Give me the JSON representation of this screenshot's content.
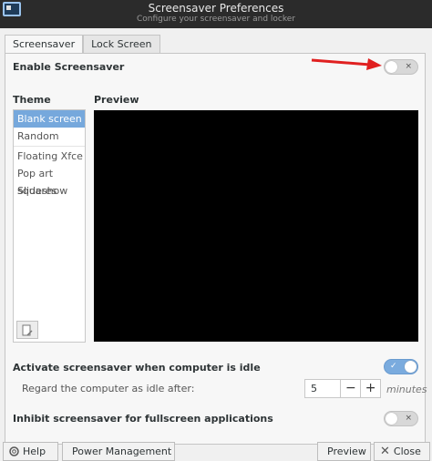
{
  "window": {
    "title": "Screensaver Preferences",
    "subtitle": "Configure your screensaver and locker"
  },
  "tabs": [
    {
      "label": "Screensaver",
      "active": true
    },
    {
      "label": "Lock Screen",
      "active": false
    }
  ],
  "enable_screensaver": {
    "label": "Enable Screensaver",
    "enabled": false
  },
  "theme": {
    "heading": "Theme",
    "items": [
      "Blank screen",
      "Random",
      "Floating Xfce",
      "Pop art squares",
      "Slideshow"
    ],
    "selected": "Blank screen"
  },
  "preview": {
    "heading": "Preview"
  },
  "activate_when_idle": {
    "label": "Activate screensaver when computer is idle",
    "enabled": true
  },
  "idle": {
    "label": "Regard the computer as idle after:",
    "value": "5",
    "unit": "minutes",
    "minus": "−",
    "plus": "+"
  },
  "inhibit_fullscreen": {
    "label": "Inhibit screensaver for fullscreen applications",
    "enabled": false
  },
  "buttons": {
    "help": "Help",
    "power_management": "Power Management",
    "preview": "Preview",
    "close": "Close"
  },
  "toggle_marks": {
    "off": "×",
    "on": "✓"
  },
  "colors": {
    "accent": "#76a8dc",
    "annotation_arrow": "#e02020"
  }
}
